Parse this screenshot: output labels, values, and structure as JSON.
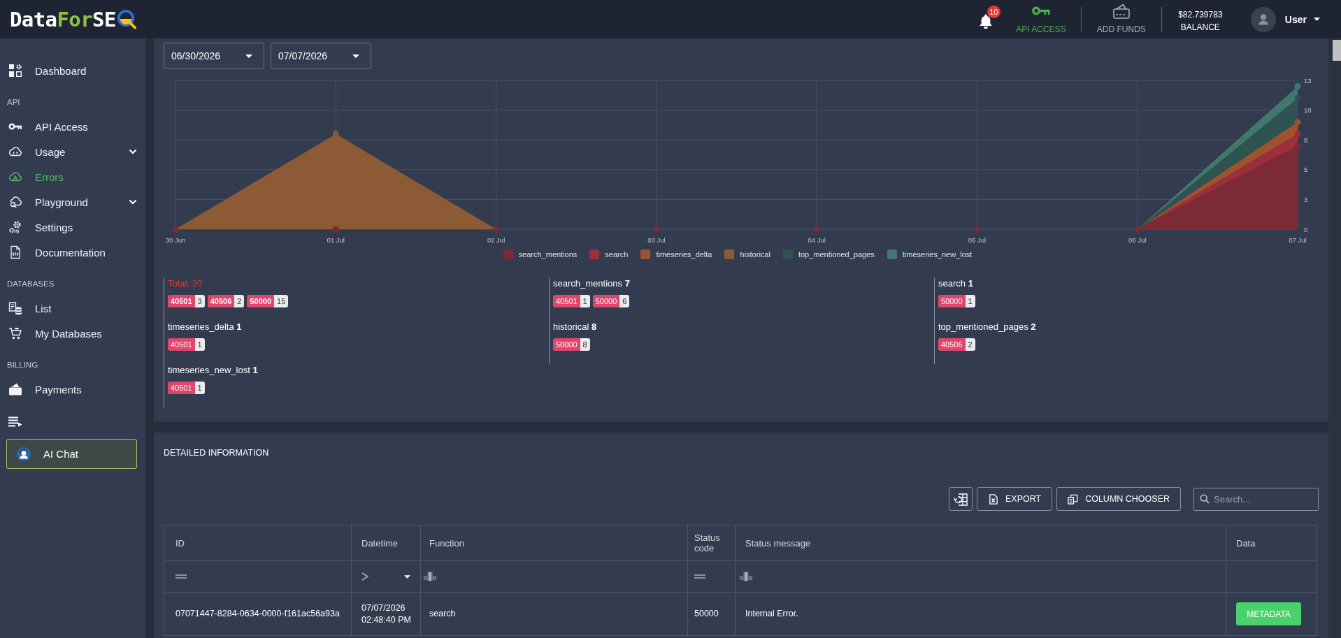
{
  "header": {
    "logo": [
      {
        "text": "Data",
        "accent": false
      },
      {
        "text": "For",
        "accent": true
      },
      {
        "text": "SE",
        "accent": false
      }
    ],
    "notifications": {
      "count": "10"
    },
    "links": [
      {
        "label": "API ACCESS",
        "accent": true
      },
      {
        "label": "ADD FUNDS",
        "accent": false
      }
    ],
    "balance": {
      "amount": "$82.739783",
      "label": "BALANCE"
    },
    "user": {
      "name": "User"
    }
  },
  "sidebar": [
    {
      "kind": "item",
      "label": "Dashboard",
      "selected": false
    },
    {
      "kind": "heading",
      "label": "API"
    },
    {
      "kind": "item",
      "label": "API Access",
      "selected": false
    },
    {
      "kind": "item",
      "label": "Usage",
      "selected": false,
      "expanded": false
    },
    {
      "kind": "item",
      "label": "Errors",
      "selected": true
    },
    {
      "kind": "item",
      "label": "Playground",
      "selected": false,
      "expanded": false
    },
    {
      "kind": "item",
      "label": "Settings",
      "selected": false
    },
    {
      "kind": "item",
      "label": "Documentation",
      "selected": false
    },
    {
      "kind": "heading",
      "label": "DATABASES"
    },
    {
      "kind": "item",
      "label": "List",
      "selected": false
    },
    {
      "kind": "item",
      "label": "My Databases",
      "selected": false
    },
    {
      "kind": "heading",
      "label": "BILLING"
    },
    {
      "kind": "item",
      "label": "Payments",
      "selected": false
    },
    {
      "kind": "toggle"
    },
    {
      "kind": "chat",
      "label": "AI Chat"
    }
  ],
  "filters": {
    "date_range": [
      "06/30/2026",
      "07/07/2026"
    ]
  },
  "chart": {
    "chart_data": {
      "type": "area",
      "stacked": true,
      "grid": true,
      "legend": "bottom",
      "categories": [
        "30 Jun",
        "01 Jul",
        "02 Jul",
        "03 Jul",
        "04 Jul",
        "05 Jul",
        "06 Jul",
        "07 Jul"
      ],
      "ylim": [
        0,
        12.5
      ],
      "yticks": [
        {
          "value": 0,
          "label": "0"
        },
        {
          "value": 2.5,
          "label": "3"
        },
        {
          "value": 5,
          "label": "5"
        },
        {
          "value": 7.5,
          "label": "8"
        },
        {
          "value": 10,
          "label": "10"
        },
        {
          "value": 12.5,
          "label": "13"
        }
      ],
      "series": [
        {
          "name": "search_mentions",
          "color": "#7b2a36",
          "values": [
            0,
            0,
            0,
            0,
            0,
            0,
            0,
            7
          ]
        },
        {
          "name": "search",
          "color": "#9b2f3a",
          "values": [
            0,
            0,
            0,
            0,
            0,
            0,
            0,
            1
          ]
        },
        {
          "name": "timeseries_delta",
          "color": "#a0522d",
          "values": [
            0,
            0,
            0,
            0,
            0,
            0,
            0,
            1
          ]
        },
        {
          "name": "historical",
          "color": "#8c5a35",
          "values": [
            0,
            8,
            0,
            null,
            null,
            null,
            null,
            null
          ]
        },
        {
          "name": "top_mentioned_pages",
          "color": "#2e5350",
          "values": [
            0,
            0,
            0,
            0,
            0,
            0,
            0,
            2
          ]
        },
        {
          "name": "timeseries_new_lost",
          "color": "#41786d",
          "values": [
            0,
            0,
            0,
            0,
            0,
            0,
            0,
            1
          ]
        }
      ]
    }
  },
  "summary": [
    {
      "kind": "total",
      "title": "Total: 20",
      "badges": [
        {
          "code": "40501",
          "count": "3"
        },
        {
          "code": "40506",
          "count": "2"
        },
        {
          "code": "50000",
          "count": "15"
        }
      ]
    },
    {
      "kind": "function",
      "title": "search_mentions **7**",
      "badges": [
        {
          "code": "40501",
          "count": "1"
        },
        {
          "code": "50000",
          "count": "6"
        }
      ]
    },
    {
      "kind": "function",
      "title": "search **1**",
      "badges": [
        {
          "code": "50000",
          "count": "1"
        }
      ]
    },
    {
      "kind": "function",
      "title": "timeseries_delta **1**",
      "badges": [
        {
          "code": "40501",
          "count": "1"
        }
      ]
    },
    {
      "kind": "function",
      "title": "historical **8**",
      "badges": [
        {
          "code": "50000",
          "count": "8"
        }
      ]
    },
    {
      "kind": "function",
      "title": "top_mentioned_pages **2**",
      "badges": [
        {
          "code": "40506",
          "count": "2"
        }
      ]
    },
    {
      "kind": "function",
      "title": "timeseries_new_lost **1**",
      "badges": [
        {
          "code": "40501",
          "count": "1"
        }
      ]
    }
  ],
  "details": {
    "title": "DETAILED INFORMATION",
    "toolbar": {
      "buttons": [
        {
          "kind": "reset"
        },
        {
          "kind": "export",
          "label": "EXPORT"
        },
        {
          "kind": "columns",
          "label": "COLUMN CHOOSER"
        }
      ],
      "search": {
        "placeholder": "Search..."
      }
    },
    "table": {
      "columns": [
        {
          "label": "ID",
          "filter": {
            "kind": "equals"
          }
        },
        {
          "label": "Datetime",
          "filter": {
            "kind": "greater"
          }
        },
        {
          "label": "Function",
          "filter": {
            "kind": "text"
          }
        },
        {
          "label": "Status code",
          "filter": {
            "kind": "equals"
          }
        },
        {
          "label": "Status message",
          "filter": {
            "kind": "text"
          }
        },
        {
          "label": "Data"
        }
      ],
      "rows": [
        {
          "cells": [
            "07071447-8284-0634-0000-f161ac56a93a",
            "07/07/2026\n02:48:40 PM",
            "search",
            "50000",
            "Internal Error."
          ],
          "action": "METADATA"
        }
      ]
    }
  }
}
